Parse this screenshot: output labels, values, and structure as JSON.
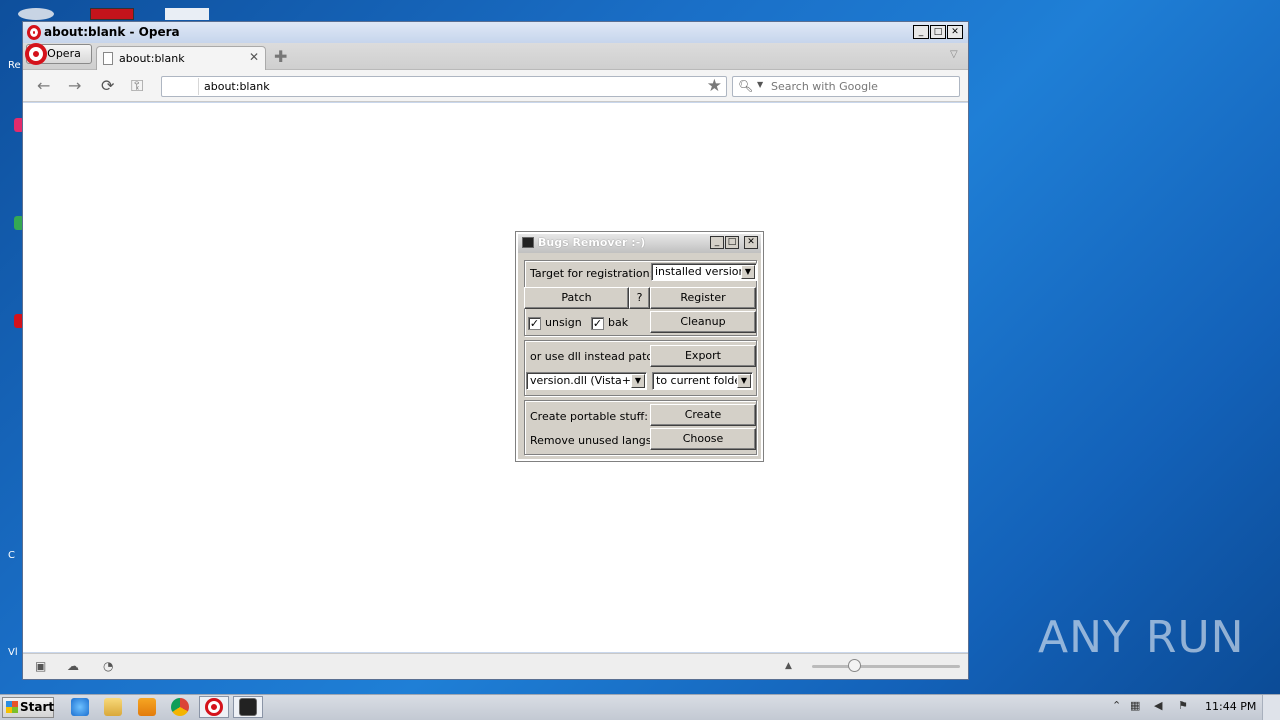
{
  "browser": {
    "window_title": "about:blank - Opera",
    "menu_label": "Opera",
    "tab_label": "about:blank",
    "address_value": "about:blank",
    "search_placeholder": "Search with Google"
  },
  "dialog": {
    "title": "Bugs Remover :-)",
    "target_label": "Target for registration:",
    "target_value": "installed version",
    "patch_label": "Patch",
    "help_label": "?",
    "register_label": "Register",
    "unsign_label": "unsign",
    "unsign_checked": true,
    "bak_label": "bak",
    "bak_checked": true,
    "cleanup_label": "Cleanup",
    "dll_label": "or use dll instead patch:",
    "export_label": "Export",
    "dll_value": "version.dll (Vista+)",
    "folder_value": "to current folder",
    "portable_label": "Create portable stuff:",
    "create_label": "Create",
    "langs_label": "Remove unused langs:",
    "choose_label": "Choose"
  },
  "watermark": "ANY RUN",
  "taskbar": {
    "start_label": "Start",
    "clock": "11:44 PM"
  },
  "desktop_fragments": [
    "Re",
    "C",
    "Vl",
    "C"
  ],
  "colors": {
    "desktop": "#1a6fc7",
    "opera_red": "#d4121b",
    "dialog_bg": "#d4d0c8"
  }
}
